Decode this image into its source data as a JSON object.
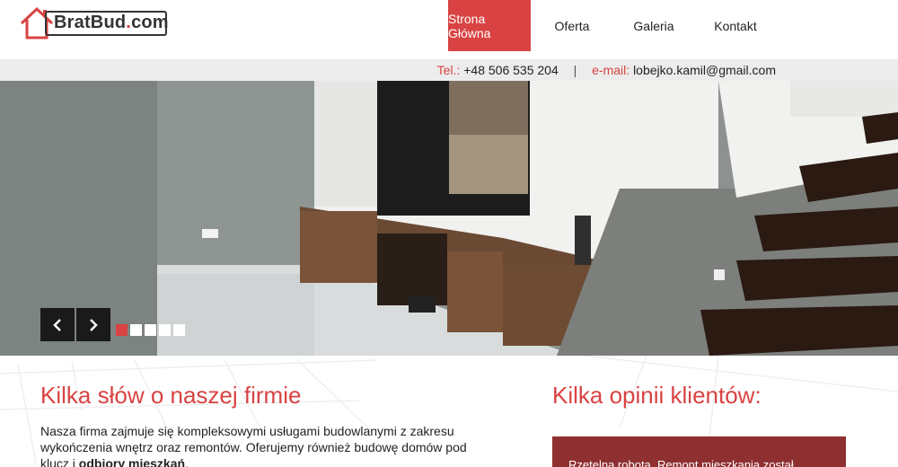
{
  "logo": {
    "brat": "BratBud",
    "dot": ".",
    "com": "com"
  },
  "nav": {
    "items": [
      {
        "label": "Strona Główna",
        "active": true
      },
      {
        "label": "Oferta"
      },
      {
        "label": "Galeria"
      },
      {
        "label": "Kontakt"
      }
    ]
  },
  "contact": {
    "tel_label": "Tel.:",
    "tel_value": "+48 506 535 204",
    "separator": "|",
    "email_label": "e-mail:",
    "email_value": "lobejko.kamil@gmail.com"
  },
  "slider": {
    "prev_icon": "chevron-left-icon",
    "next_icon": "chevron-right-icon",
    "slide_count": 5,
    "active_slide": 1
  },
  "about": {
    "heading": "Kilka słów o naszej firmie",
    "text_a": "Nasza firma zajmuje się kompleksowymi usługami budowlanymi z zakresu wykończenia wnętrz oraz remontów. Oferujemy również budowę domów pod klucz i ",
    "text_bold": "odbiory mieszkań",
    "text_b": "."
  },
  "opinions": {
    "heading": "Kilka opinii klientów:",
    "first_text": "Rzetelna robota. Remont mieszkania został"
  },
  "colors": {
    "accent": "#d94343",
    "contact_bar": "#ececec",
    "dark": "#1a1a1a"
  }
}
